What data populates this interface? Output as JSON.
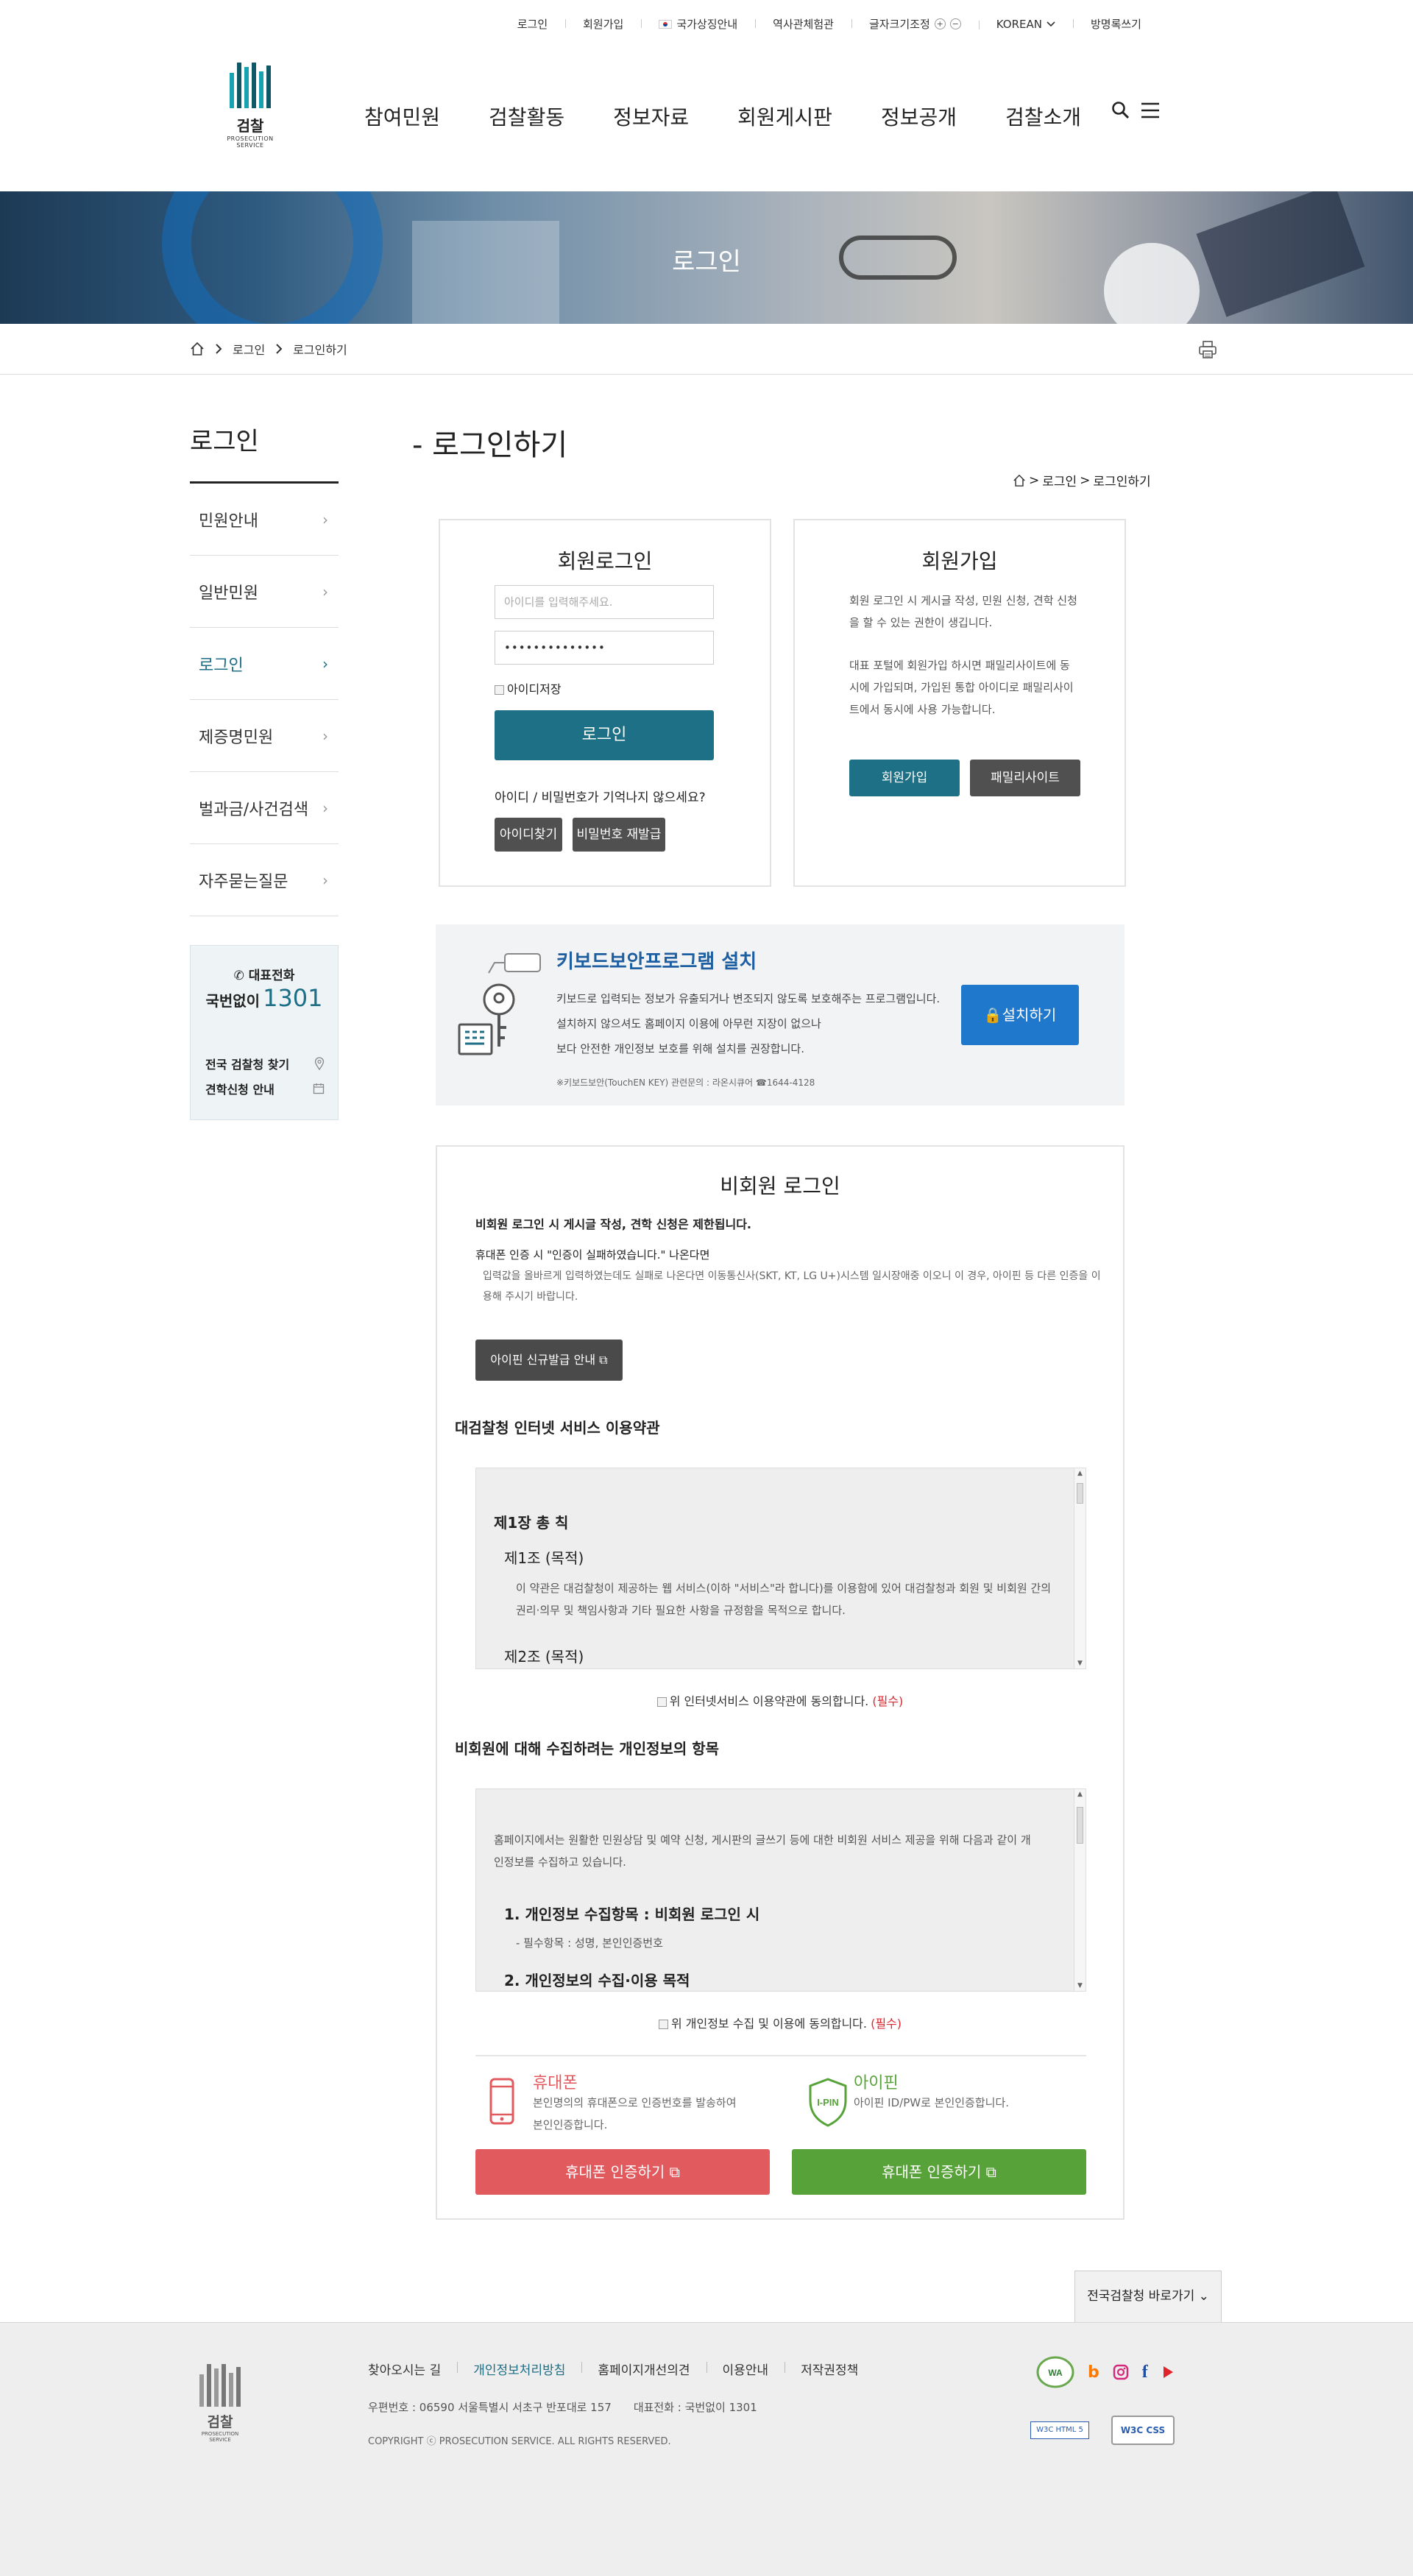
{
  "util": {
    "login": "로그인",
    "join": "회원가입",
    "gov": "국가상징안내",
    "history": "역사관체험관",
    "fontsize": "글자크기조정",
    "zoom_in": "+",
    "zoom_out": "−",
    "lang": "KOREAN",
    "sitemap": "방명록쓰기"
  },
  "logo": {
    "name": "검찰",
    "sub": "PROSECUTION SERVICE"
  },
  "gnb": [
    "참여민원",
    "검찰활동",
    "정보자료",
    "회원게시판",
    "정보공개",
    "검찰소개"
  ],
  "banner": {
    "title": "로그인"
  },
  "breadcrumb": {
    "level1": "로그인",
    "level2": "로그인하기"
  },
  "lnb": {
    "title": "로그인",
    "items": [
      "민원안내",
      "일반민원",
      "로그인",
      "제증명민원",
      "벌과금/사건검색",
      "자주묻는질문"
    ],
    "call": {
      "label": "대표전화",
      "prefix": "국번없이",
      "number": "1301",
      "link1": "전국 검찰청 찾기",
      "link2": "견학신청 안내"
    }
  },
  "content": {
    "title": "- 로그인하기",
    "loc_level1": "로그인",
    "loc_sep": ">",
    "loc_level2": "로그인하기"
  },
  "login_box": {
    "title": "회원로그인",
    "id_placeholder": "아이디를 입력해주세요.",
    "pw_value": "••••••••••••••",
    "save_id": "아이디저장",
    "login_btn": "로그인",
    "forgot": "아이디 / 비밀번호가 기억나지 않으세요?",
    "find_id": "아이디찾기",
    "reset_pw": "비밀번호 재발급"
  },
  "join_box": {
    "title": "회원가입",
    "desc1": "회원 로그인 시 게시글 작성, 민원 신청, 견학 신청을 할 수 있는 권한이 생깁니다.",
    "desc2": "대표 포털에 회원가입 하시면 패밀리사이트에 동시에 가입되며, 가입된 통합 아이디로 패밀리사이트에서 동시에 사용 가능합니다.",
    "join_btn": "회원가입",
    "family_btn": "패밀리사이트"
  },
  "keyboard": {
    "title": "키보드보안프로그램 설치",
    "line1": "키보드로 입력되는 정보가 유출되거나 변조되지 않도록 보호해주는 프로그램입니다.",
    "line2": "설치하지 않으셔도 홈페이지 이용에 아무런 지장이 없으나",
    "line3": "보다 안전한 개인정보 보호를 위해 설치를 권장합니다.",
    "note": "※키보드보안(TouchEN KEY) 관련문의 : 라온시큐어 ☎1644-4128",
    "install_btn": "설치하기"
  },
  "nonmember": {
    "title": "비회원 로그인",
    "notice1": "비회원 로그인 시 게시글 작성, 견학 신청은 제한됩니다.",
    "notice2": "휴대폰 인증 시 \"인증이 실패하였습니다.\" 나온다면",
    "notice3": "입력값을 올바르게 입력하였는데도 실패로 나온다면 이동통신사(SKT, KT, LG U+)시스템 일시장애중 이오니 이 경우, 아이핀 등 다른 인증을 이용해 주시기 바랍니다.",
    "ipin_guide_btn": "아이핀 신규발급 안내",
    "terms_heading": "대검찰청 인터넷 서비스 이용약관",
    "terms_chapter": "제1장 총 칙",
    "terms_art1": "제1조 (목적)",
    "terms_art1_text": "이 약관은 대검찰청이 제공하는 웹 서비스(이하 \"서비스\"라 합니다)를 이용함에 있어 대검찰청과 회원 및 비회원 간의 권리·의무 및 책임사항과 기타 필요한 사항을 규정함을 목적으로 합니다.",
    "terms_art2": "제2조 (목적)",
    "agree_terms": "위 인터넷서비스 이용약관에 동의합니다.",
    "required": "(필수)",
    "privacy_heading": "비회원에 대해 수집하려는 개인정보의 항목",
    "privacy_intro": "홈페이지에서는 원활한 민원상담 및 예약 신청, 게시판의 글쓰기 등에 대한 비회원 서비스 제공을 위해 다음과 같이 개인정보를 수집하고 있습니다.",
    "privacy_item1": "1. 개인정보 수집항목 : 비회원 로그인 시",
    "privacy_item1_sub": "- 필수항목 : 성명, 본인인증번호",
    "privacy_item2": "2. 개인정보의 수집·이용 목적",
    "agree_privacy": "위 개인정보 수집 및 이용에 동의합니다.",
    "phone_title": "휴대폰",
    "phone_desc1": "본인명의의 휴대폰으로 인증번호를 발송하여",
    "phone_desc2": "본인인증합니다.",
    "ipin_title": "아이핀",
    "ipin_desc": "아이핀 ID/PW로 본인인증합니다.",
    "ipin_logo": "I-PIN",
    "phone_btn": "휴대폰 인증하기",
    "ipin_btn": "휴대폰 인증하기"
  },
  "footer": {
    "site_btn": "전국검찰청 바로가기",
    "links": [
      "찾아오시는 길",
      "개인정보처리방침",
      "홈페이지개선의견",
      "이용안내",
      "저작권정책"
    ],
    "address": "우편번호 : 06590 서울특별시 서초구 반포대로 157",
    "phone": "대표전화 : 국번없이 1301",
    "copyright": "COPYRIGHT ⓒ PROSECUTION SERVICE. ALL RIGHTS RESERVED.",
    "badge_wa": "WA",
    "badge_w3c": "W3C HTML 5",
    "badge_css": "W3C CSS"
  },
  "colors": {
    "teal": "#1d7085",
    "accent": "#1d6e86",
    "dark_btn": "#505050",
    "phone": "#e05a5e",
    "ipin": "#58a23a",
    "required": "#d9272e"
  }
}
